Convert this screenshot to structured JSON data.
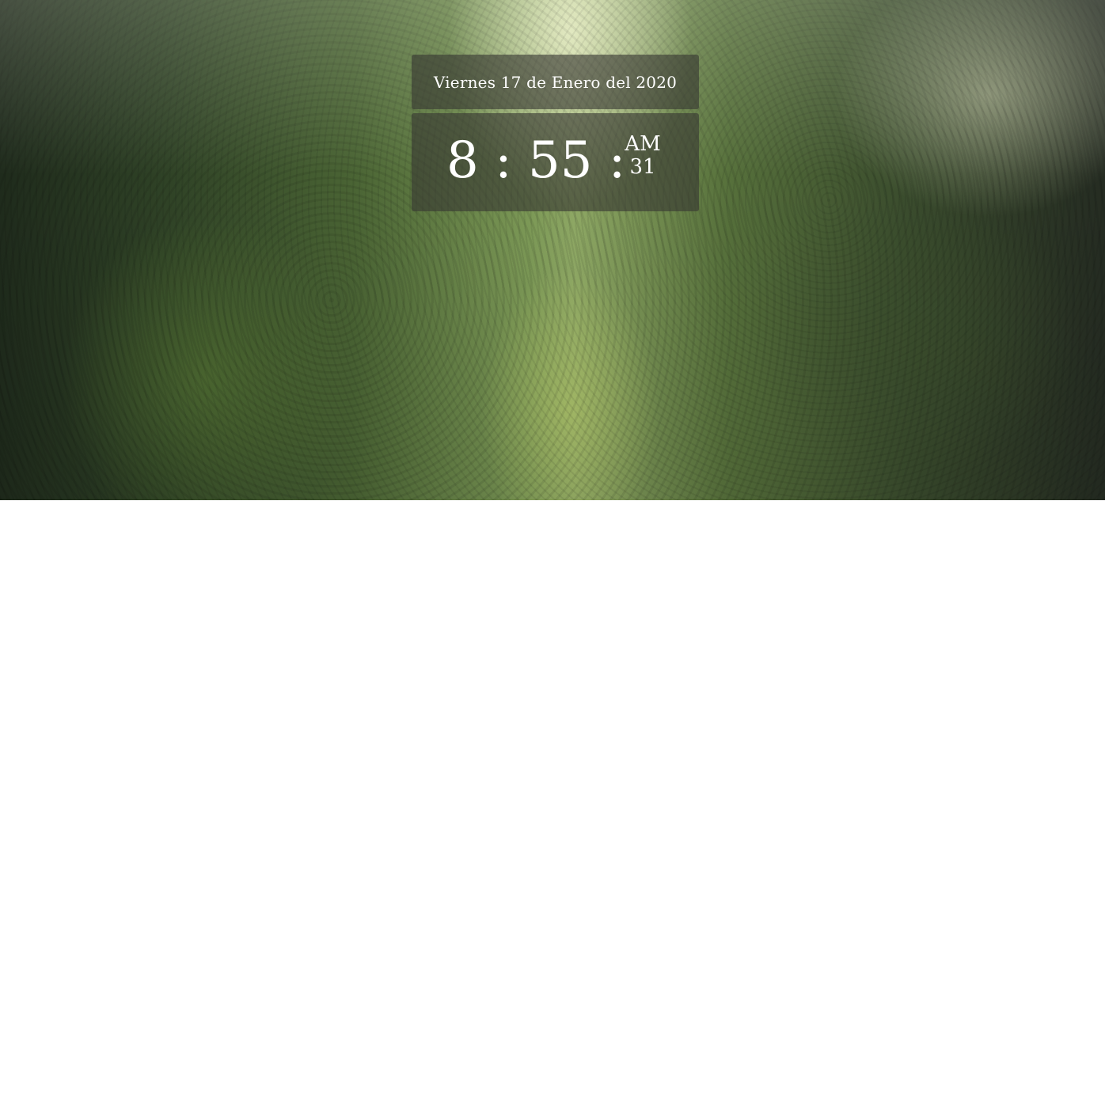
{
  "date": {
    "text": "Viernes 17 de Enero del 2020"
  },
  "clock": {
    "hours": "8",
    "separator": ":",
    "minutes": "55",
    "ampm": "AM",
    "seconds": "31"
  },
  "background": {
    "description_colors": [
      "#2f4226",
      "#7d9a57",
      "#252c22"
    ]
  }
}
